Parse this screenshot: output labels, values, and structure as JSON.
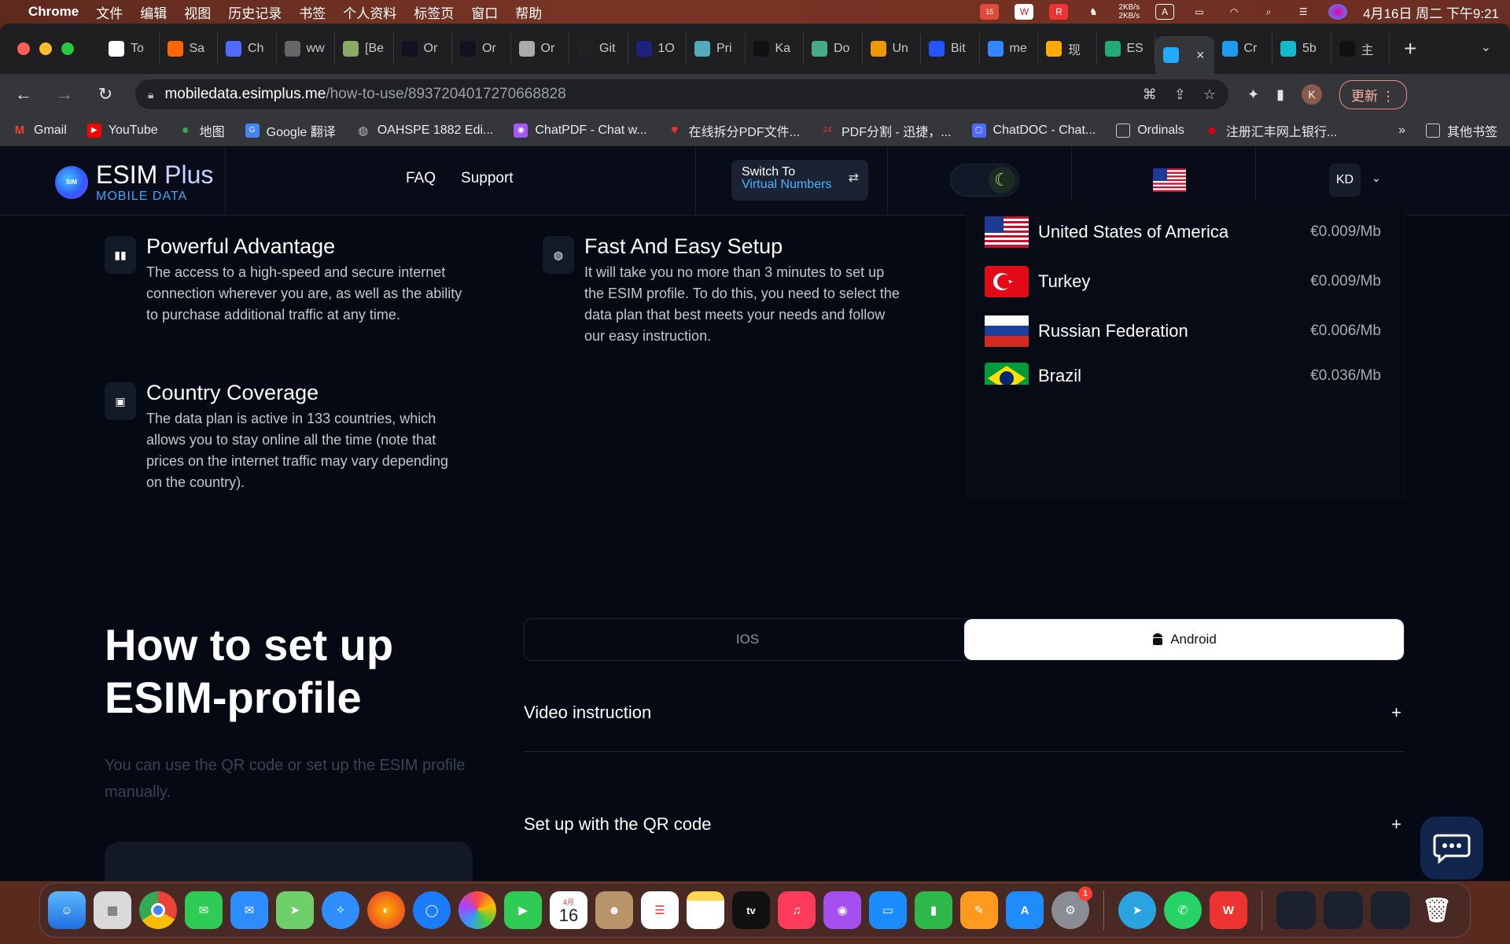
{
  "menubar": {
    "app_name": "Chrome",
    "menus": [
      "文件",
      "编辑",
      "视图",
      "历史记录",
      "书签",
      "个人资料",
      "标签页",
      "窗口",
      "帮助"
    ],
    "net_up": "2KB/s",
    "net_down": "2KB/s",
    "input_source": "A",
    "badge_count": "15",
    "datetime": "4月16日 周二 下午9:21"
  },
  "browser": {
    "tabs": [
      "To",
      "Sa",
      "Ch",
      "ww",
      "[Be",
      "Or",
      "Or",
      "Or",
      "Git",
      "1O",
      "Pri",
      "Ka",
      "Do",
      "Un",
      "Bit",
      "me",
      "现",
      "ES",
      "",
      "Cr",
      "5b",
      "主"
    ],
    "active_tab_index": 18,
    "url_host": "mobiledata.esimplus.me",
    "url_path": "/how-to-use/8937204017270668828",
    "avatar_letter": "K",
    "update_label": "更新",
    "bookmarks": [
      "Gmail",
      "YouTube",
      "地图",
      "Google 翻译",
      "OAHSPE 1882 Edi...",
      "ChatPDF - Chat w...",
      "在线拆分PDF文件...",
      "PDF分割 - 迅捷，...",
      "ChatDOC - Chat...",
      "Ordinals",
      "注册汇丰网上银行..."
    ],
    "bookmarks_more": "»",
    "other_bookmarks": "其他书签"
  },
  "site": {
    "logo_main": "ESIM",
    "logo_plus": "Plus",
    "logo_sub": "MOBILE DATA",
    "logo_badge": "SIM",
    "nav": [
      "FAQ",
      "Support"
    ],
    "switch_line1": "Switch To",
    "switch_line2": "Virtual Numbers",
    "lang": "KD"
  },
  "features": [
    {
      "title": "Powerful Advantage",
      "desc": "The access to a high-speed and secure internet connection wherever you are, as well as the ability to purchase additional traffic at any time.",
      "icon": "bar-chart-icon"
    },
    {
      "title": "Fast And Easy Setup",
      "desc": "It will take you no more than 3 minutes to set up the ESIM profile. To do this, you need to select the data plan that best meets your needs and follow our easy instruction.",
      "icon": "globe-icon"
    },
    {
      "title": "Country Coverage",
      "desc": "The data plan is active in 133 countries, which allows you to stay online all the time (note that prices on the internet traffic may vary depending on the country).",
      "icon": "wallet-icon"
    }
  ],
  "prices": [
    {
      "country": "United States of America",
      "price": "€0.009/Mb",
      "flag": "us"
    },
    {
      "country": "Turkey",
      "price": "€0.009/Mb",
      "flag": "tr"
    },
    {
      "country": "Russian Federation",
      "price": "€0.006/Mb",
      "flag": "ru"
    },
    {
      "country": "Brazil",
      "price": "€0.036/Mb",
      "flag": "br"
    }
  ],
  "howto": {
    "title_line1": "How to set up",
    "title_line2": "ESIM-profile",
    "subtitle": "You can use the QR code or set up the ESIM profile manually.",
    "os_tabs": [
      "IOS",
      "Android"
    ],
    "active_os": "Android",
    "accordions": [
      "Video instruction",
      "Set up with the QR code"
    ]
  },
  "dock": {
    "calendar_month": "4月",
    "calendar_day": "16",
    "settings_badge": "1",
    "apps": [
      "finder-icon",
      "launchpad-icon",
      "chrome-icon",
      "messages-icon",
      "mail-icon",
      "maps-icon",
      "safari-icon",
      "firefox-icon",
      "quicklook-icon",
      "photos-icon",
      "facetime-icon",
      "calendar-icon",
      "contacts-icon",
      "reminders-icon",
      "notes-icon",
      "appletv-icon",
      "music-icon",
      "podcasts-icon",
      "keynote-icon",
      "numbers-icon",
      "pages-icon",
      "appstore-icon",
      "settings-icon",
      "telegram-icon",
      "whatsapp-icon",
      "wps-icon",
      "trash-icon"
    ]
  }
}
